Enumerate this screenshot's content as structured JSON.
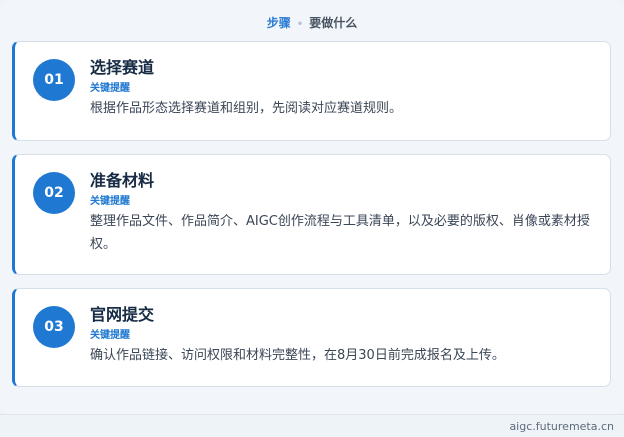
{
  "breadcrumb": {
    "step": "步骤",
    "what": "要做什么"
  },
  "steps": [
    {
      "number": "01",
      "title": "选择赛道",
      "tag": "关键提醒",
      "description": "根据作品形态选择赛道和组别，先阅读对应赛道规则。"
    },
    {
      "number": "02",
      "title": "准备材料",
      "tag": "关键提醒",
      "description": "整理作品文件、作品简介、AIGC创作流程与工具清单，以及必要的版权、肖像或素材授权。"
    },
    {
      "number": "03",
      "title": "官网提交",
      "tag": "关键提醒",
      "description": "确认作品链接、访问权限和材料完整性，在8月30日前完成报名及上传。"
    }
  ],
  "footer": {
    "domain": "aigc.futuremeta.cn"
  },
  "colors": {
    "accent": "#1f78d1",
    "title": "#172b45",
    "background": "#f2f6fa"
  }
}
